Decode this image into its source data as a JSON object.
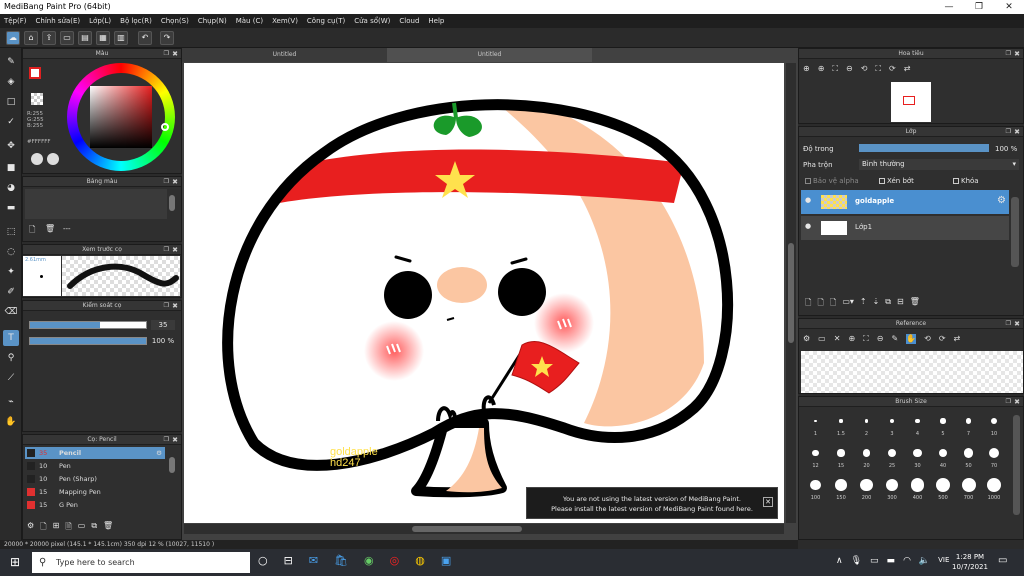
{
  "app": {
    "title": "MediBang Paint Pro (64bit)"
  },
  "menu": [
    "Tệp(F)",
    "Chỉnh sửa(E)",
    "Lớp(L)",
    "Bộ lọc(R)",
    "Chọn(S)",
    "Chụp(N)",
    "Màu (C)",
    "Xem(V)",
    "Công cụ(T)",
    "Cửa sổ(W)",
    "Cloud",
    "Help"
  ],
  "color_panel": {
    "title": "Màu",
    "rgb_r": "R:255",
    "rgb_g": "G:255",
    "rgb_b": "B:255",
    "hex": "#FFFFFF"
  },
  "palette_panel": {
    "title": "Bảng màu",
    "dash": "---"
  },
  "brush_preview": {
    "title": "Xem trước cọ",
    "size": "2.61mm"
  },
  "brush_control": {
    "title": "Kiểm soát cọ",
    "size_value": "35",
    "opacity_value": "100 %",
    "size_fill": 0.6,
    "opacity_fill": 1.0
  },
  "brush_list": {
    "title": "Cọ: Pencil",
    "items": [
      {
        "size": "35",
        "name": "Pencil",
        "color": "#222222",
        "selected": true
      },
      {
        "size": "10",
        "name": "Pen",
        "color": "#222222",
        "selected": false
      },
      {
        "size": "10",
        "name": "Pen (Sharp)",
        "color": "#222222",
        "selected": false
      },
      {
        "size": "15",
        "name": "Mapping Pen",
        "color": "#e03030",
        "selected": false
      },
      {
        "size": "15",
        "name": "G Pen",
        "color": "#e03030",
        "selected": false
      }
    ]
  },
  "tabs": [
    "Untitled",
    "Untitled"
  ],
  "canvas": {
    "signature": "goldapple",
    "signature2": "hd247"
  },
  "notice": {
    "line1": "You are not using the latest version of MediBang Paint.",
    "line2": "Please install the latest version of MediBang Paint found here.",
    "close": "✕"
  },
  "status_bar": "20000 * 20000 pixel  (145.1 * 145.1cm)  350 dpi  12 %  (10027, 11510 )",
  "navigator": {
    "title": "Hoa tiêu"
  },
  "layer_panel": {
    "title": "Lớp",
    "opacity_label": "Độ trong",
    "opacity_value": "100 %",
    "opacity_fill": 1.0,
    "blend_label": "Pha trộn",
    "blend_value": "Bình thường",
    "protect_alpha": "Bảo vệ alpha",
    "clipping": "Xén bớt",
    "lock": "Khóa",
    "layers": [
      {
        "name": "goldapple",
        "selected": true
      },
      {
        "name": "Lớp1",
        "selected": false
      }
    ]
  },
  "reference": {
    "title": "Reference"
  },
  "brush_size": {
    "title": "Brush Size",
    "sizes": [
      "1",
      "1.5",
      "2",
      "3",
      "4",
      "5",
      "7",
      "10",
      "12",
      "15",
      "20",
      "25",
      "30",
      "40",
      "50",
      "70",
      "100",
      "150",
      "200",
      "300",
      "400",
      "500",
      "700",
      "1000"
    ]
  },
  "taskbar": {
    "search_placeholder": "Type here to search",
    "time": "1:28 PM",
    "date": "10/7/2021",
    "lang": "VIE"
  },
  "colors": {
    "accent": "#5a93c6",
    "red": "#e81f1f",
    "skin": "#fbc6a2"
  }
}
